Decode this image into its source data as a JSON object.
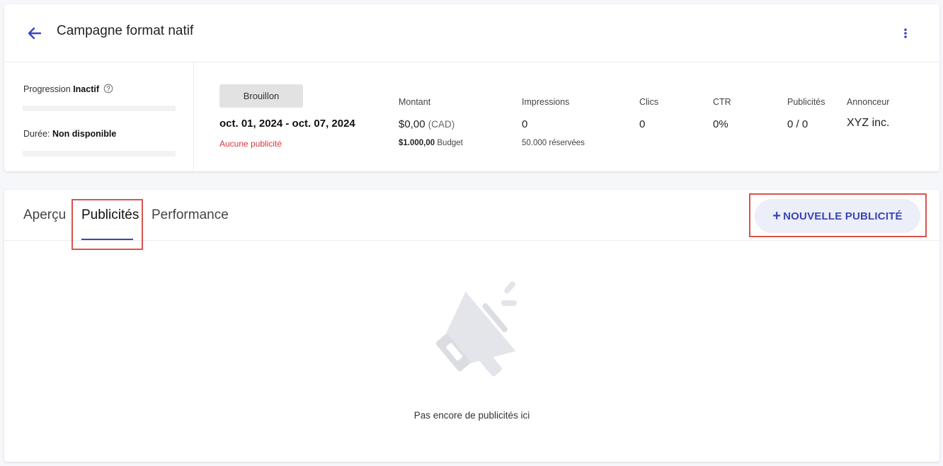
{
  "header": {
    "title": "Campagne format natif",
    "back_icon": "arrow-left-icon",
    "more_icon": "more-vertical-icon"
  },
  "progress": {
    "label": "Progression",
    "value": "Inactif"
  },
  "duration": {
    "label": "Durée:",
    "value": "Non disponible"
  },
  "status": {
    "badge": "Brouillon",
    "date_range": "oct. 01, 2024 - oct. 07, 2024",
    "warning": "Aucune publicité"
  },
  "stats": {
    "montant": {
      "label": "Montant",
      "value": "$0,00",
      "unit": "(CAD)",
      "sub_value": "$1.000,00",
      "sub_label": "Budget"
    },
    "impressions": {
      "label": "Impressions",
      "value": "0",
      "sub": "50.000 réservées"
    },
    "clics": {
      "label": "Clics",
      "value": "0"
    },
    "ctr": {
      "label": "CTR",
      "value": "0%"
    },
    "publicites": {
      "label": "Publicités",
      "value": "0 / 0"
    },
    "annonceur": {
      "label": "Annonceur",
      "value": "XYZ inc."
    }
  },
  "tabs": [
    {
      "label": "Aperçu"
    },
    {
      "label": "Publicités",
      "active": true
    },
    {
      "label": "Performance"
    }
  ],
  "actions": {
    "new_ad_plus": "+",
    "new_ad_label": "NOUVELLE PUBLICITÉ"
  },
  "empty_state": {
    "icon": "megaphone-icon",
    "text": "Pas encore de publicités ici"
  },
  "colors": {
    "accent": "#3845c4",
    "warning": "#d9353b",
    "highlight": "#d9534f"
  }
}
